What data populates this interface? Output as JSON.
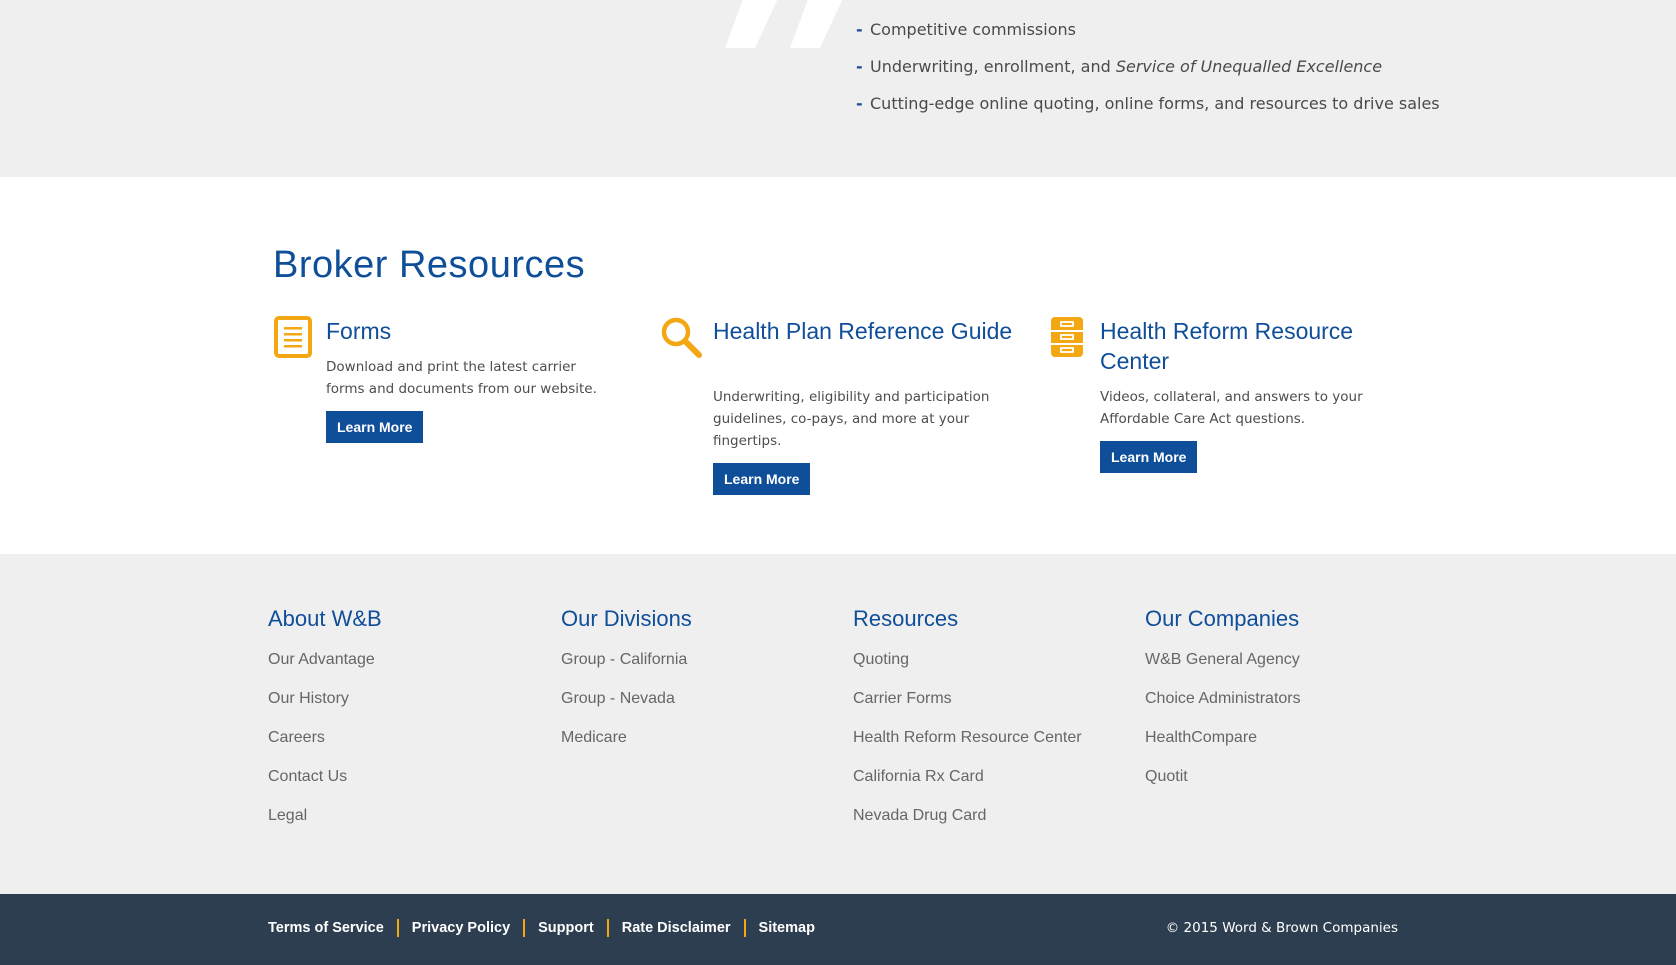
{
  "benefits": {
    "items": [
      {
        "text": "Competitive commissions"
      },
      {
        "text": "Underwriting, enrollment, and ",
        "emphasis": "Service of Unequalled Excellence"
      },
      {
        "text": "Cutting-edge online quoting, online forms, and resources to drive sales"
      }
    ],
    "bullet": "-"
  },
  "broker_resources": {
    "title": "Broker Resources",
    "cards": [
      {
        "icon": "document-icon",
        "title": "Forms",
        "description": "Download and print the latest carrier forms and documents from our website.",
        "button": "Learn More"
      },
      {
        "icon": "magnifier-icon",
        "title": "Health Plan Reference Guide",
        "description": "Underwriting, eligibility and participation guidelines, co-pays, and more at your fingertips.",
        "button": "Learn More"
      },
      {
        "icon": "file-cabinet-icon",
        "title": "Health Reform Resource Center",
        "description": "Videos, collateral, and answers to your Affordable Care Act questions.",
        "button": "Learn More"
      }
    ]
  },
  "footer": {
    "columns": [
      {
        "heading": "About W&B",
        "links": [
          "Our Advantage",
          "Our History",
          "Careers",
          "Contact Us",
          "Legal"
        ]
      },
      {
        "heading": "Our Divisions",
        "links": [
          "Group - California",
          "Group - Nevada",
          "Medicare"
        ]
      },
      {
        "heading": "Resources",
        "links": [
          "Quoting",
          "Carrier Forms",
          "Health Reform Resource Center",
          "California Rx Card",
          "Nevada Drug Card"
        ]
      },
      {
        "heading": "Our Companies",
        "links": [
          "W&B General Agency",
          "Choice Administrators",
          "HealthCompare",
          "Quotit"
        ]
      }
    ]
  },
  "bottom_bar": {
    "links": [
      "Terms of Service",
      "Privacy Policy",
      "Support",
      "Rate Disclaimer",
      "Sitemap"
    ],
    "copyright": "© 2015 Word & Brown Companies"
  },
  "colors": {
    "brand_blue": "#0f4e99",
    "accent_orange": "#f3a712",
    "dark_bar": "#2d3e50",
    "light_grey": "#efefef"
  }
}
